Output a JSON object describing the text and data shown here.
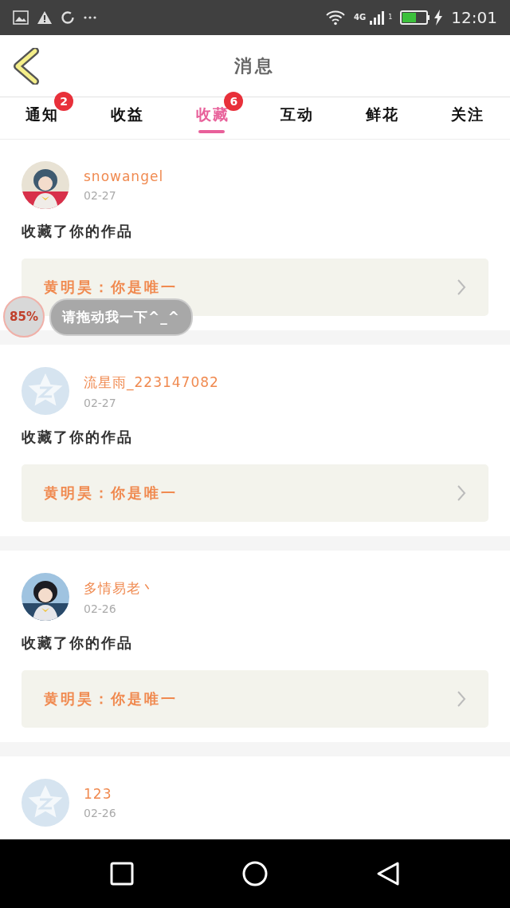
{
  "status_bar": {
    "network": "4G",
    "sim": "1",
    "time": "12:01"
  },
  "header": {
    "title": "消息"
  },
  "tabs": [
    {
      "label": "通知",
      "selected": false,
      "badge": "2"
    },
    {
      "label": "收益",
      "selected": false
    },
    {
      "label": "收藏",
      "selected": true,
      "badge": "6"
    },
    {
      "label": "互动",
      "selected": false
    },
    {
      "label": "鲜花",
      "selected": false
    },
    {
      "label": "关注",
      "selected": false
    }
  ],
  "messages": [
    {
      "name": "snowangel",
      "date": "02-27",
      "action": "收藏了你的作品",
      "work": "黄明昊：你是唯一"
    },
    {
      "avatar": {
        "kind": "default"
      },
      "name": "流星雨_223147082",
      "date": "02-27",
      "action": "收藏了你的作品",
      "work": "黄明昊：你是唯一"
    },
    {
      "name": "多情易老丶",
      "date": "02-26",
      "action": "收藏了你的作品",
      "work": "黄明昊：你是唯一"
    },
    {
      "avatar": {
        "kind": "default"
      },
      "name": "123",
      "date": "02-26"
    }
  ],
  "floating_helper": {
    "percent": "85%",
    "hint": "请拖动我一下^_^"
  }
}
